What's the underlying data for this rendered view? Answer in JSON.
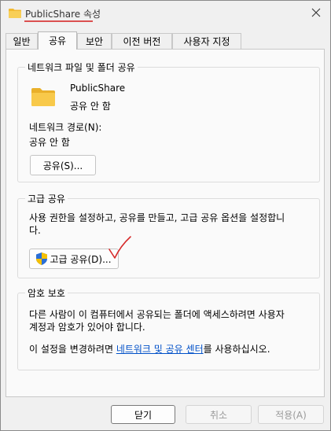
{
  "window": {
    "title": "PublicShare 속성",
    "close_label": "×"
  },
  "tabs": [
    {
      "label": "일반",
      "active": false
    },
    {
      "label": "공유",
      "active": true
    },
    {
      "label": "보안",
      "active": false
    },
    {
      "label": "이전 버전",
      "active": false
    },
    {
      "label": "사용자 지정",
      "active": false
    }
  ],
  "network_sharing": {
    "group_title": "네트워크 파일 및 폴더 공유",
    "folder_name": "PublicShare",
    "folder_status": "공유 안 함",
    "path_label": "네트워크 경로(N):",
    "path_value": "공유 안 함",
    "share_button": "공유(S)..."
  },
  "advanced_sharing": {
    "group_title": "고급 공유",
    "description": "사용 권한을 설정하고, 공유를 만들고, 고급 공유 옵션을 설정합니다.",
    "description_line1": "사용 권한을 설정하고, 공유를 만들고, 고급 공유 옵션을 설정합니",
    "description_line2": "다.",
    "button": "고급 공유(D)..."
  },
  "password_protection": {
    "group_title": "암호 보호",
    "line1": "다른 사람이 이 컴퓨터에서 공유되는 폴더에 액세스하려면 사용자",
    "line2": "계정과 암호가 있어야 합니다.",
    "change_prefix": "이 설정을 변경하려면 ",
    "change_link": "네트워크 및 공유 센터",
    "change_suffix": "를 사용하십시오."
  },
  "footer": {
    "close_button": "닫기",
    "cancel_button": "취소",
    "apply_button": "적용(A)"
  },
  "colors": {
    "folder_yellow": "#f8c94a",
    "title_underline": "#d83a3a",
    "annotation_mark": "#d62a2a",
    "link": "#0050c8",
    "shield_blue": "#2b6fd6",
    "shield_yellow": "#f6c000"
  }
}
